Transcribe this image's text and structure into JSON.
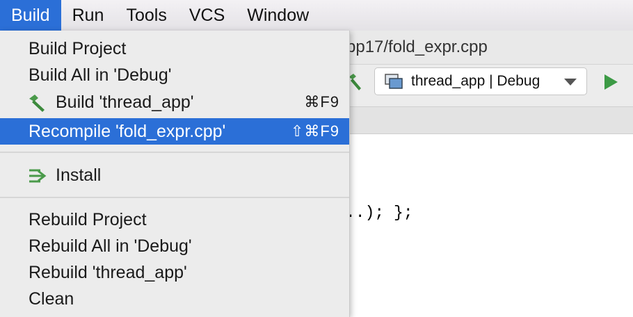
{
  "menubar": {
    "items": [
      "Build",
      "Run",
      "Tools",
      "VCS",
      "Window"
    ]
  },
  "ide": {
    "title": "pp17/fold_expr.cpp",
    "run_config": "thread_app | Debug",
    "code_line": "..); };"
  },
  "build_menu": {
    "build_project": "Build Project",
    "build_all_debug": "Build All in 'Debug'",
    "build_thread_app": "Build 'thread_app'",
    "build_thread_app_shortcut": "⌘F9",
    "recompile": "Recompile 'fold_expr.cpp'",
    "recompile_shortcut": "⇧⌘F9",
    "install": "Install",
    "rebuild_project": "Rebuild Project",
    "rebuild_all_debug": "Rebuild All in 'Debug'",
    "rebuild_thread_app": "Rebuild 'thread_app'",
    "clean": "Clean"
  },
  "colors": {
    "highlight": "#2b6fd7",
    "hammer_green": "#4a9a4a",
    "run_green": "#3c9a45"
  }
}
